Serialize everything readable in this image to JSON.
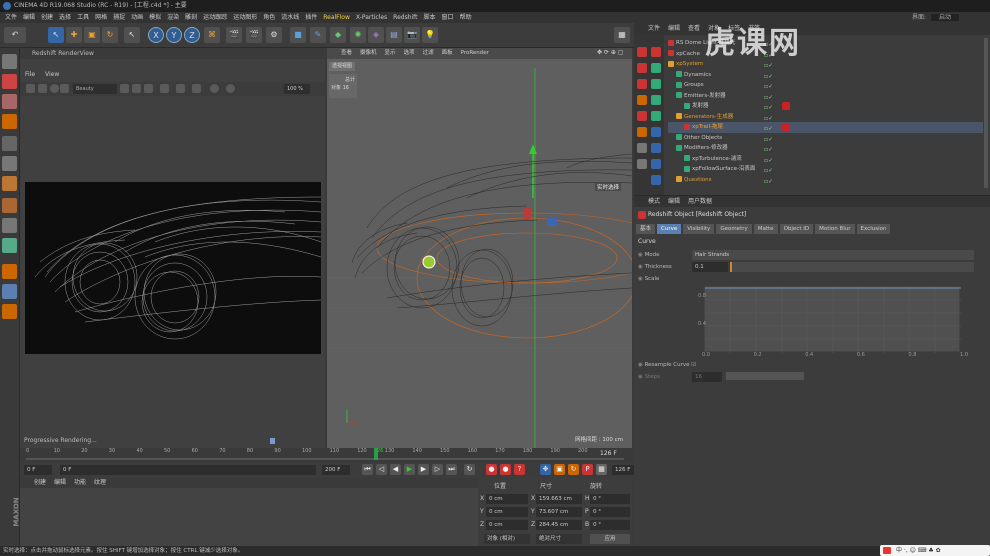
{
  "window": {
    "title": "CINEMA 4D R19.068 Studio (RC - R19) - [工程.c4d *] - 主要"
  },
  "menubar": {
    "items": [
      "文件",
      "编辑",
      "创建",
      "选择",
      "工具",
      "网格",
      "捕捉",
      "动画",
      "模拟",
      "渲染",
      "雕刻",
      "运动跟踪",
      "运动图形",
      "角色",
      "流水线",
      "插件",
      "RealFlow",
      "X-Particles",
      "Redshift",
      "脚本",
      "窗口",
      "帮助"
    ],
    "highlight": "RealFlow",
    "layout_label": "界面:",
    "layout_value": "启动"
  },
  "toolbar": {
    "axis_x": "X",
    "axis_y": "Y",
    "axis_z": "Z",
    "icons": [
      "undo-icon",
      "select-icon",
      "move-icon",
      "scale-icon",
      "rotate-icon",
      "axis-x",
      "axis-y",
      "axis-z",
      "coord-icon",
      "render-region-icon",
      "render-view-icon",
      "render-settings-icon",
      "cube-icon",
      "pen-icon",
      "subdivision-icon",
      "array-icon",
      "deformer-icon",
      "floor-icon",
      "camera-icon",
      "light-icon"
    ]
  },
  "renderview": {
    "title": "Redshift RenderView",
    "menu": [
      "File",
      "View"
    ],
    "status_select": "Beauty",
    "zoom": "100 %",
    "progress_label": "Progressive Rendering..."
  },
  "viewport": {
    "menu": [
      "查看",
      "摄像机",
      "显示",
      "选项",
      "过滤",
      "面板",
      "ProRender"
    ],
    "view_label": "透视视图",
    "stats": {
      "header": "总计",
      "label": "对象",
      "value": "16"
    },
    "selection_label": "实时选择",
    "grid_spacing": "网格间距 : 100 cm"
  },
  "timeline": {
    "ticks": [
      "0",
      "10",
      "20",
      "30",
      "40",
      "50",
      "60",
      "70",
      "80",
      "90",
      "100",
      "110",
      "120",
      "126",
      "130",
      "140",
      "150",
      "160",
      "170",
      "180",
      "190",
      "200"
    ],
    "current_frame": "126 F",
    "start_field": "0 F",
    "range_start": "0 F",
    "range_end": "200 F",
    "end_field": "200 F",
    "frame_field": "126 F"
  },
  "material_panel": {
    "menu": [
      "创建",
      "编辑",
      "功能",
      "纹理"
    ]
  },
  "coords": {
    "headers": [
      "位置",
      "尺寸",
      "旋转"
    ],
    "rows": [
      {
        "axis": "X",
        "pos": "0 cm",
        "size": "159.663 cm",
        "rot_label": "H",
        "rot": "0 °"
      },
      {
        "axis": "Y",
        "pos": "0 cm",
        "size": "73.607 cm",
        "rot_label": "P",
        "rot": "0 °"
      },
      {
        "axis": "Z",
        "pos": "0 cm",
        "size": "284.45 cm",
        "rot_label": "B",
        "rot": "0 °"
      }
    ],
    "mode_select": "对象 (相对)",
    "size_select": "绝对尺寸",
    "apply": "应用"
  },
  "object_manager": {
    "menu": [
      "文件",
      "编辑",
      "查看",
      "对象",
      "标签",
      "书签"
    ],
    "items": [
      {
        "label": "RS Dome Light-环境光",
        "color": "#c33",
        "indent": 0,
        "tag": false
      },
      {
        "label": "xpCache",
        "color": "#c33",
        "indent": 0,
        "tag": false
      },
      {
        "label": "xpSystem",
        "color": "#e0a030",
        "indent": 0,
        "tag": false
      },
      {
        "label": "Dynamics",
        "color": "#3a7",
        "indent": 1,
        "tag": false
      },
      {
        "label": "Groups",
        "color": "#3a7",
        "indent": 1,
        "tag": false
      },
      {
        "label": "Emitters-发射器",
        "color": "#3a7",
        "indent": 1,
        "tag": false
      },
      {
        "label": "发射器",
        "color": "#3a7",
        "indent": 2,
        "tag": true
      },
      {
        "label": "Generators-生成器",
        "color": "#e0a030",
        "indent": 1,
        "tag": false
      },
      {
        "label": "xpTrail-拖尾",
        "color": "#c33",
        "indent": 2,
        "tag": true
      },
      {
        "label": "Other Objects",
        "color": "#3a7",
        "indent": 1,
        "tag": false
      },
      {
        "label": "Modifiers-修改器",
        "color": "#3a7",
        "indent": 1,
        "tag": false
      },
      {
        "label": "xpTurbulence-湍流",
        "color": "#3a7",
        "indent": 2,
        "tag": false
      },
      {
        "label": "xpFollowSurface-沿表面",
        "color": "#3a7",
        "indent": 2,
        "tag": false
      },
      {
        "label": "Questions",
        "color": "#e0a030",
        "indent": 1,
        "tag": false
      }
    ]
  },
  "attributes": {
    "menu": [
      "模式",
      "编辑",
      "用户数据"
    ],
    "title": "Redshift Object [Redshift Object]",
    "tabs": [
      "基本",
      "Curve",
      "Visibility",
      "Geometry",
      "Matte",
      "Object ID",
      "Motion Blur",
      "Exclusion"
    ],
    "active_tab": "Curve",
    "section": "Curve",
    "mode_label": "Mode",
    "mode_value": "Hair Strands",
    "thickness_label": "Thickness",
    "thickness_value": "0.1",
    "scale_label": "Scale",
    "graph_x_ticks": [
      "0.0",
      "0.2",
      "0.4",
      "0.6",
      "0.8",
      "1.0"
    ],
    "graph_y_ticks": [
      "0.8",
      "0.4"
    ],
    "resample_label": "Resample Curve",
    "steps_label": "Steps",
    "steps_value": "16"
  },
  "status": {
    "text": "实时选择：点击并拖动鼠标选择元素。按住 SHIFT 键增加选择对象；按住 CTRL 键减少选择对象。"
  },
  "watermark": {
    "text": "虎课网"
  },
  "ime": {
    "text": "中 ·, ☺ ⌨ ♣ ✿"
  }
}
